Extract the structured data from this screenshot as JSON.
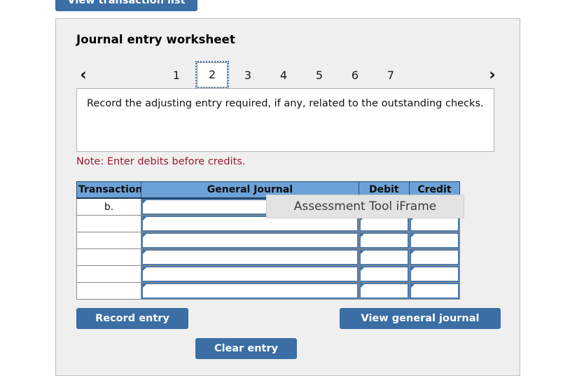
{
  "top_button": {
    "label": "View transaction list"
  },
  "panel": {
    "title": "Journal entry worksheet"
  },
  "tab_nav": {
    "prev_icon": "‹",
    "next_icon": "›",
    "tabs": [
      {
        "label": "1",
        "selected": false
      },
      {
        "label": "2",
        "selected": true
      },
      {
        "label": "3",
        "selected": false
      },
      {
        "label": "4",
        "selected": false
      },
      {
        "label": "5",
        "selected": false
      },
      {
        "label": "6",
        "selected": false
      },
      {
        "label": "7",
        "selected": false
      }
    ]
  },
  "instruction": {
    "text": "Record the adjusting entry required, if any, related to the outstanding checks."
  },
  "note": {
    "text": "Note: Enter debits before credits."
  },
  "table": {
    "columns": [
      "Transaction",
      "General Journal",
      "Debit",
      "Credit"
    ],
    "rows": [
      {
        "transaction": "b.",
        "general_journal": "",
        "debit": "",
        "credit": ""
      },
      {
        "transaction": "",
        "general_journal": "",
        "debit": "",
        "credit": ""
      },
      {
        "transaction": "",
        "general_journal": "",
        "debit": "",
        "credit": ""
      },
      {
        "transaction": "",
        "general_journal": "",
        "debit": "",
        "credit": ""
      },
      {
        "transaction": "",
        "general_journal": "",
        "debit": "",
        "credit": ""
      },
      {
        "transaction": "",
        "general_journal": "",
        "debit": "",
        "credit": ""
      }
    ]
  },
  "actions": {
    "record_entry": "Record entry",
    "clear_entry": "Clear entry",
    "view_general_journal": "View general journal"
  },
  "tooltip": {
    "text": "Assessment Tool iFrame"
  },
  "colors": {
    "button_blue": "#3a6ea5",
    "table_header_blue": "#6da2d8",
    "note_red": "#9c1b2e",
    "panel_bg": "#efefef",
    "cell_border_blue": "#4d7aab"
  }
}
